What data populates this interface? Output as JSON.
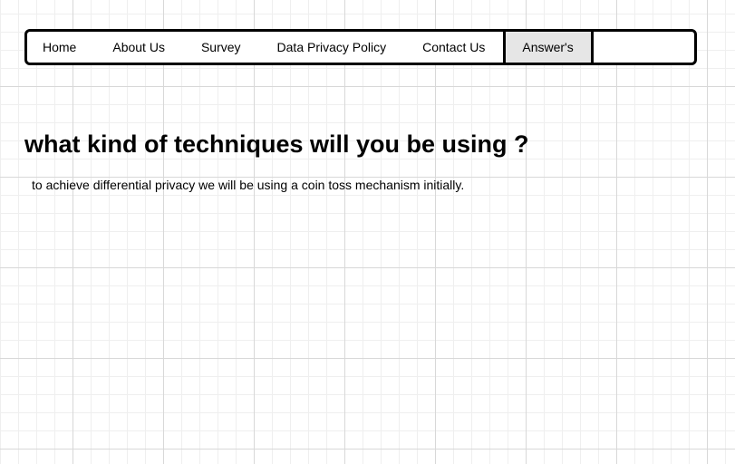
{
  "nav": {
    "items": [
      {
        "label": "Home"
      },
      {
        "label": "About Us"
      },
      {
        "label": "Survey"
      },
      {
        "label": "Data Privacy Policy"
      },
      {
        "label": "Contact Us"
      },
      {
        "label": "Answer's",
        "active": true
      }
    ]
  },
  "content": {
    "title": "what kind of techniques will you be using ?",
    "text": "to achieve differential privacy we will be using a coin toss mechanism initially."
  }
}
